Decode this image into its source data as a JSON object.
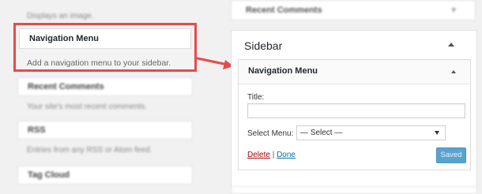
{
  "highlighted_widget": {
    "title": "Navigation Menu",
    "description": "Add a navigation menu to your sidebar."
  },
  "background_widgets": [
    {
      "title": "Recent Comments",
      "description": "Your site's most recent comments."
    },
    {
      "title": "RSS",
      "description": "Entries from any RSS or Atom feed."
    },
    {
      "title": "Tag Cloud",
      "description": ""
    }
  ],
  "background_top_text": "Displays an image.",
  "right_top_widget": {
    "title": "Recent Comments"
  },
  "sidebar": {
    "title": "Sidebar",
    "widget": {
      "title": "Navigation Menu",
      "title_label": "Title:",
      "title_value": "",
      "select_label": "Select Menu:",
      "select_value": "— Select —",
      "delete_label": "Delete",
      "separator": "|",
      "done_label": "Done",
      "saved_label": "Saved"
    }
  },
  "colors": {
    "highlight_border": "#e84a4a",
    "link_blue": "#0073aa",
    "delete_red": "#a00000",
    "saved_button": "#5aa3cf"
  },
  "icons": [
    "arrow-right-icon",
    "caret-up-icon",
    "dropdown-arrow-icon"
  ]
}
